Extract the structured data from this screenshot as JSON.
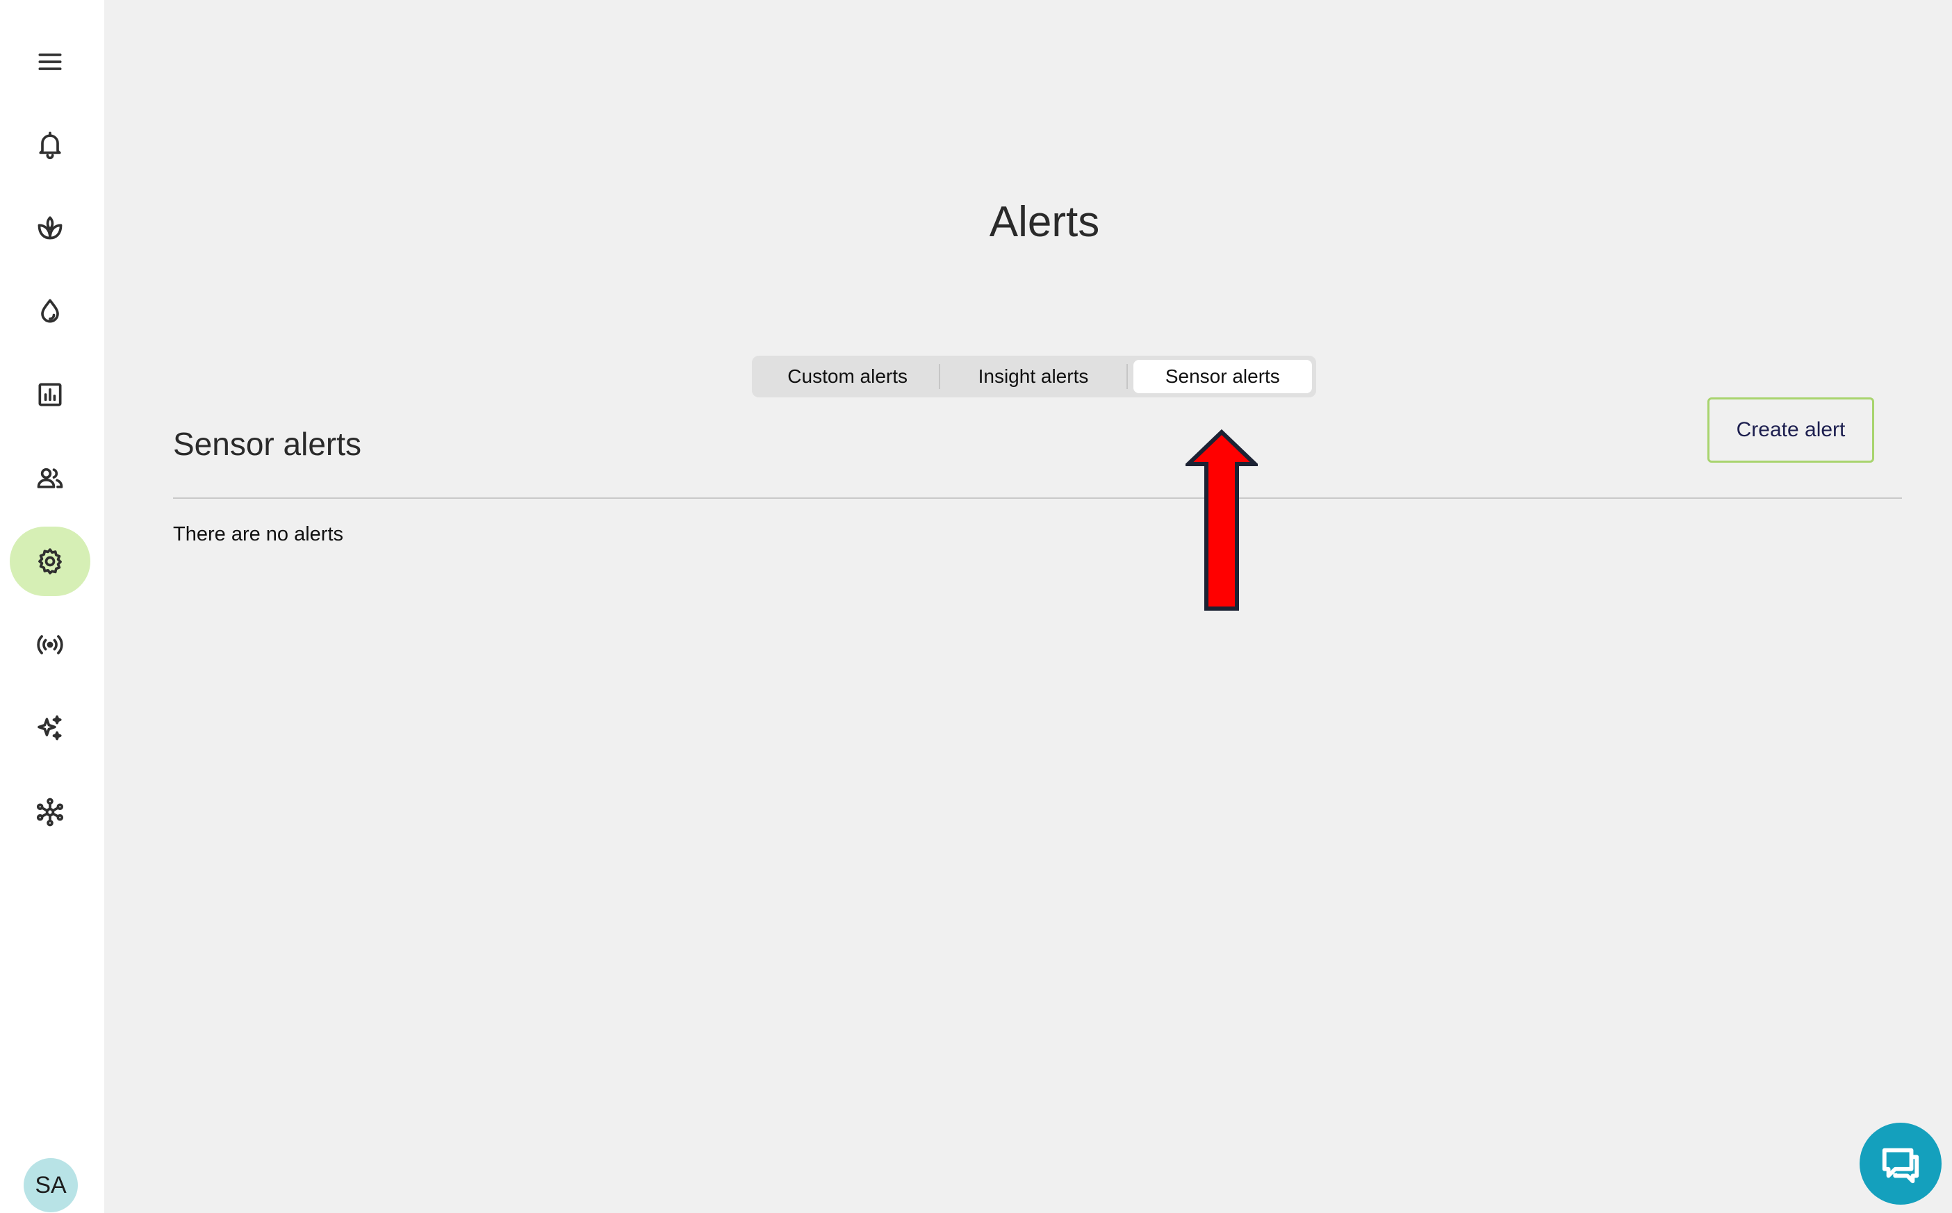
{
  "sidebar": {
    "items": [
      {
        "icon": "menu-icon"
      },
      {
        "icon": "bell-icon"
      },
      {
        "icon": "plant-icon"
      },
      {
        "icon": "water-drop-icon"
      },
      {
        "icon": "chart-icon"
      },
      {
        "icon": "users-icon"
      },
      {
        "icon": "gear-icon",
        "active": true
      },
      {
        "icon": "sensor-broadcast-icon"
      },
      {
        "icon": "sparkle-icon"
      },
      {
        "icon": "network-icon"
      }
    ],
    "avatar_initials": "SA"
  },
  "main": {
    "title": "Alerts",
    "tabs": [
      {
        "label": "Custom alerts"
      },
      {
        "label": "Insight alerts"
      },
      {
        "label": "Sensor alerts",
        "selected": true
      }
    ],
    "section_title": "Sensor alerts",
    "create_button_label": "Create alert",
    "empty_message": "There are no alerts"
  },
  "colors": {
    "active_nav": "#d6efb5",
    "create_button_border": "#a8d46e",
    "chat_fab": "#14a0bd",
    "annotation_arrow": "#ff0000"
  },
  "chat": {
    "icon": "chat-icon"
  }
}
